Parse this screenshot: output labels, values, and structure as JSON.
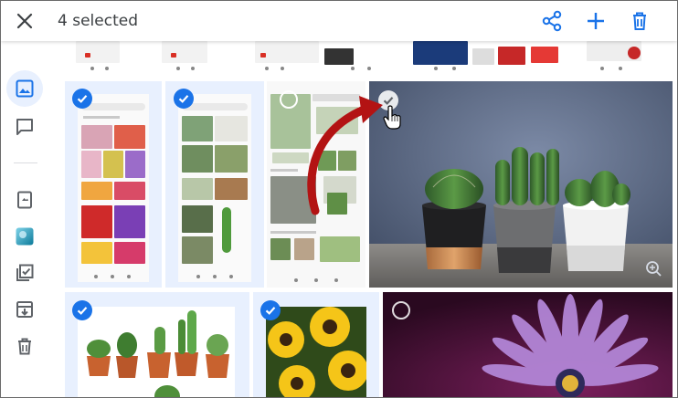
{
  "header": {
    "selected_text": "4 selected"
  },
  "icons": {
    "close": "close-icon",
    "share": "share-icon",
    "add": "add-icon",
    "delete": "trash-icon"
  },
  "sidebar": {
    "items": [
      {
        "name": "photos-icon",
        "active": true
      },
      {
        "name": "sharing-icon",
        "active": false
      },
      {
        "name": "albums-icon",
        "active": false
      },
      {
        "name": "assistant-icon",
        "active": false
      },
      {
        "name": "utilities-icon",
        "active": false
      },
      {
        "name": "archive-icon",
        "active": false
      },
      {
        "name": "trash-icon",
        "active": false
      }
    ]
  },
  "photos": [
    {
      "name": "photo-phone-flowers",
      "selected": true
    },
    {
      "name": "photo-phone-cacti",
      "selected": true
    },
    {
      "name": "photo-phone-cacti-2",
      "selected": true
    },
    {
      "name": "photo-cactus-pots",
      "selected": true,
      "hovered": true
    },
    {
      "name": "photo-cacti-white",
      "selected": true
    },
    {
      "name": "photo-yellow-flowers",
      "selected": true
    },
    {
      "name": "photo-purple-flower",
      "selected": false
    }
  ],
  "colors": {
    "accent": "#1a73e8",
    "selected_bg": "#e8f0fe",
    "icon": "#5f6368",
    "arrow": "#b31313"
  }
}
